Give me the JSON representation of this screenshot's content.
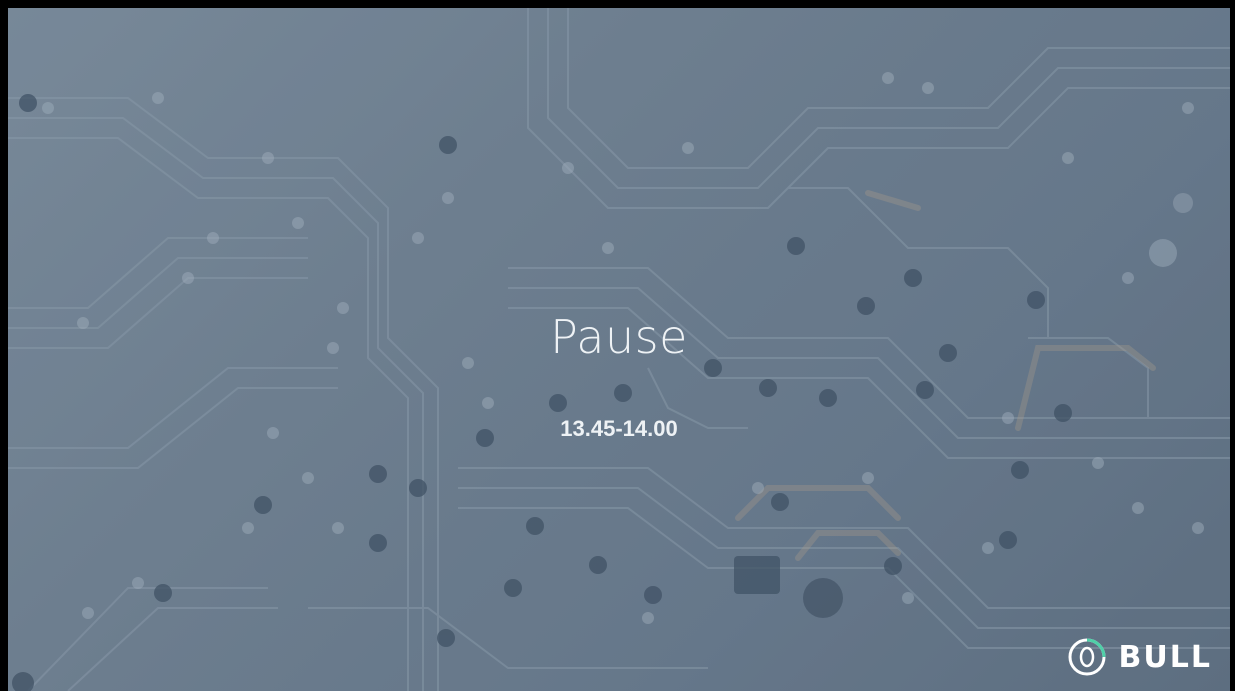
{
  "slide": {
    "title": "Pause",
    "time": "13.45-14.00"
  },
  "logo": {
    "text": "BULL",
    "icon": "bull-logo-mark-icon"
  },
  "colors": {
    "background": "#6e7f8f",
    "text": "#eef2f5",
    "logo_accent": "#4fd0a8"
  }
}
